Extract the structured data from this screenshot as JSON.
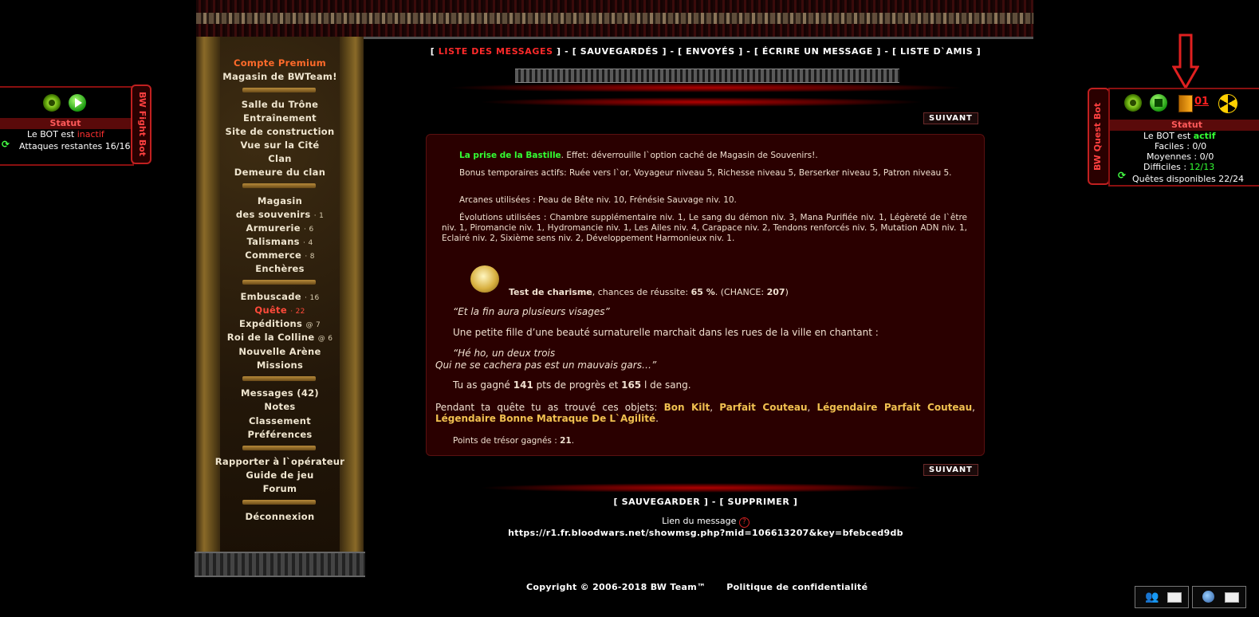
{
  "nav": {
    "premium": "Compte Premium",
    "shop_bwteam": "Magasin de BWTeam!",
    "group1": [
      "Salle du Trône",
      "Entraînement",
      "Site de construction",
      "Vue sur la Cité",
      "Clan",
      "Demeure du clan"
    ],
    "magasin1": "Magasin",
    "magasin2": "des souvenirs",
    "magasin_cnt": "· 1",
    "armurerie": "Armurerie",
    "armurerie_cnt": "· 6",
    "talismans": "Talismans",
    "talismans_cnt": "· 4",
    "commerce": "Commerce",
    "commerce_cnt": "· 8",
    "encheres": "Enchères",
    "embuscade": "Embuscade",
    "embuscade_cnt": "· 16",
    "quete": "Quête",
    "quete_cnt": "· 22",
    "expeditions": "Expéditions",
    "expeditions_cnt": "@ 7",
    "roi": "Roi de la Colline",
    "roi_cnt": "@ 6",
    "arene": "Nouvelle Arène",
    "missions": "Missions",
    "messages": "Messages (42)",
    "notes": "Notes",
    "classement": "Classement",
    "preferences": "Préférences",
    "rapporter": "Rapporter à l`opérateur",
    "guide": "Guide de jeu",
    "forum": "Forum",
    "deconnexion": "Déconnexion"
  },
  "tabs": {
    "open1": "[ ",
    "liste": "LISTE DES MESSAGES",
    "sep1": " ] - [ ",
    "sauvegardes": "SAUVEGARDÉS",
    "sep2": " ] - [ ",
    "envoyes": "ENVOYÉS",
    "sep3": " ] - [ ",
    "ecrire": "ÉCRIRE UN MESSAGE",
    "sep4": " ] - [ ",
    "amis": "LISTE D`AMIS",
    "close": " ]"
  },
  "suivant": "SUIVANT",
  "message": {
    "quest_title": "La prise de la Bastille",
    "quest_effect": ". Effet: déverrouille l`option caché de Magasin de Souvenirs!.",
    "bonus": "Bonus temporaires actifs: Ruée vers l`or, Voyageur niveau 5, Richesse niveau 5, Berserker niveau 5, Patron niveau 5.",
    "arcanes": "Arcanes utilisées : Peau de Bête niv. 10, Frénésie Sauvage niv. 10.",
    "evolutions": "Évolutions utilisées : Chambre supplémentaire niv. 1, Le sang du démon niv. 3, Mana Purifiée niv. 1, Légèreté de l`être niv. 1, Piromancie niv. 1, Hydromancie niv. 1, Les Ailes niv. 4, Carapace niv. 2, Tendons renforcés niv. 5, Mutation ADN niv. 1, Eclairé niv. 2, Sixième sens niv. 2, Développement Harmonieux niv. 1.",
    "test_label": "Test de charisme",
    "test_mid": ", chances de réussite: ",
    "test_pct": "65 %",
    "test_chance_pre": ". (CHANCE: ",
    "test_chance_val": "207",
    "test_chance_post": ")",
    "quote1": "“Et la fin aura plusieurs visages”",
    "story": "Une petite fille d’une beauté surnaturelle marchait dans les rues de la ville en chantant :",
    "quote2a": "“Hé ho, un deux trois",
    "quote2b": "Qui ne se cachera pas est un mauvais gars…”",
    "gain_pre": "Tu as gagné ",
    "gain_pts": "141",
    "gain_mid": " pts de progrès et ",
    "gain_sang": "165",
    "gain_post": " l de sang.",
    "objets_pre": "Pendant ta quête tu as trouvé ces objets: ",
    "obj1": "Bon Kilt",
    "obj2": "Parfait Couteau",
    "obj3": "Légendaire Parfait Couteau",
    "obj4": "Légendaire Bonne Matraque De L`Agilité",
    "comma": ", ",
    "period": ".",
    "tresor_pre": "Points de trésor gagnés : ",
    "tresor_val": "21",
    "tresor_post": "."
  },
  "actions": {
    "open": "[ ",
    "sauvegarder": "SAUVEGARDER",
    "sep": " ] - [ ",
    "supprimer": "SUPPRIMER",
    "close": " ]"
  },
  "link_label": "Lien du message",
  "link_url": "https://r1.fr.bloodwars.net/showmsg.php?mid=106613207&key=bfebced9db",
  "footer": {
    "copyright": "Copyright © 2006-2018 BW Team™",
    "privacy": "Politique de confidentialité"
  },
  "fight_bot": {
    "tab": "BW Fight Bot",
    "status_title": "Statut",
    "bot_pre": "Le BOT est ",
    "bot_state": "inactif",
    "attacks": "Attaques restantes 16/16"
  },
  "quest_bot": {
    "tab": "BW Quest Bot",
    "counter": "01",
    "status_title": "Statut",
    "bot_pre": "Le BOT est ",
    "bot_state": "actif",
    "faciles": "Faciles : 0/0",
    "moyennes": "Moyennes : 0/0",
    "difficiles_pre": "Difficiles : ",
    "difficiles_val": "12/13",
    "quetes": "Quêtes disponibles 22/24"
  },
  "colors": {
    "accent_red": "#ff2a2a",
    "green": "#33ff33",
    "gold": "#f0c050",
    "panel": "#2a0000"
  }
}
